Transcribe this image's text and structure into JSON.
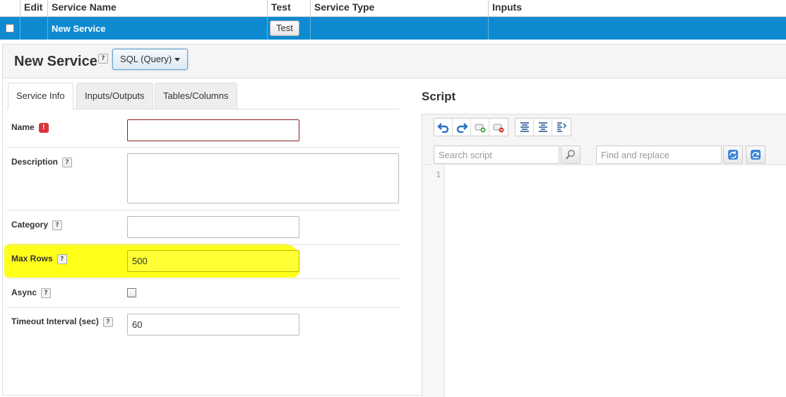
{
  "grid": {
    "headers": [
      "Edit",
      "Service Name",
      "Test",
      "Service Type",
      "Inputs"
    ],
    "row": {
      "name": "New Service",
      "test_label": "Test",
      "service_type": "",
      "inputs": ""
    }
  },
  "editor": {
    "title": "New Service",
    "help_glyph": "?",
    "type_selector": "SQL (Query)",
    "tabs": [
      "Service Info",
      "Inputs/Outputs",
      "Tables/Columns"
    ],
    "active_tab": "Service Info",
    "required_glyph": "!",
    "fields": {
      "name": {
        "label": "Name",
        "value": ""
      },
      "description": {
        "label": "Description",
        "value": ""
      },
      "category": {
        "label": "Category",
        "value": ""
      },
      "max_rows": {
        "label": "Max Rows",
        "value": "500"
      },
      "async": {
        "label": "Async",
        "checked": false
      },
      "timeout": {
        "label": "Timeout Interval (sec)",
        "value": "60"
      }
    },
    "highlight_color": "#ffff1a"
  },
  "script": {
    "title": "Script",
    "toolbar_icons": [
      "undo-icon",
      "redo-icon",
      "add-comment-icon",
      "remove-comment-icon",
      "indent-icon",
      "outdent-icon",
      "format-icon"
    ],
    "search_placeholder": "Search script",
    "find_replace_placeholder": "Find and replace",
    "line_numbers": [
      "1"
    ]
  },
  "colors": {
    "selected_row": "#0e8ad0",
    "accent": "#2f7ec7",
    "error": "#d9363e"
  }
}
